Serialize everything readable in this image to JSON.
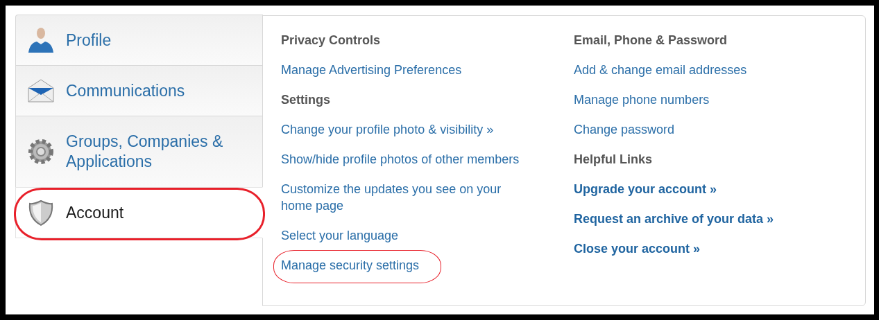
{
  "sidebar": {
    "items": [
      {
        "label": "Profile",
        "selected": false,
        "circled": false
      },
      {
        "label": "Communications",
        "selected": false,
        "circled": false
      },
      {
        "label": "Groups, Companies & Applications",
        "selected": false,
        "circled": false
      },
      {
        "label": "Account",
        "selected": true,
        "circled": true
      }
    ]
  },
  "columns": [
    {
      "items": [
        {
          "kind": "heading",
          "text": "Privacy Controls",
          "circled": false
        },
        {
          "kind": "link",
          "text": "Manage Advertising Preferences",
          "circled": false
        },
        {
          "kind": "heading",
          "text": "Settings",
          "circled": false
        },
        {
          "kind": "link",
          "text": "Change your profile photo & visibility »",
          "circled": false
        },
        {
          "kind": "link",
          "text": "Show/hide profile photos of other members",
          "circled": false
        },
        {
          "kind": "link",
          "text": "Customize the updates you see on your home page",
          "circled": false
        },
        {
          "kind": "link",
          "text": "Select your language",
          "circled": false
        },
        {
          "kind": "link",
          "text": "Manage security settings",
          "circled": true
        }
      ]
    },
    {
      "items": [
        {
          "kind": "heading",
          "text": "Email, Phone & Password",
          "circled": false
        },
        {
          "kind": "link",
          "text": "Add & change email addresses",
          "circled": false
        },
        {
          "kind": "link",
          "text": "Manage phone numbers",
          "circled": false
        },
        {
          "kind": "link",
          "text": "Change password",
          "circled": false
        },
        {
          "kind": "heading",
          "text": "Helpful Links",
          "circled": false
        },
        {
          "kind": "strong_link",
          "text": "Upgrade your account »",
          "circled": false
        },
        {
          "kind": "strong_link",
          "text": "Request an archive of your data »",
          "circled": false
        },
        {
          "kind": "strong_link",
          "text": "Close your account »",
          "circled": false
        }
      ]
    }
  ]
}
